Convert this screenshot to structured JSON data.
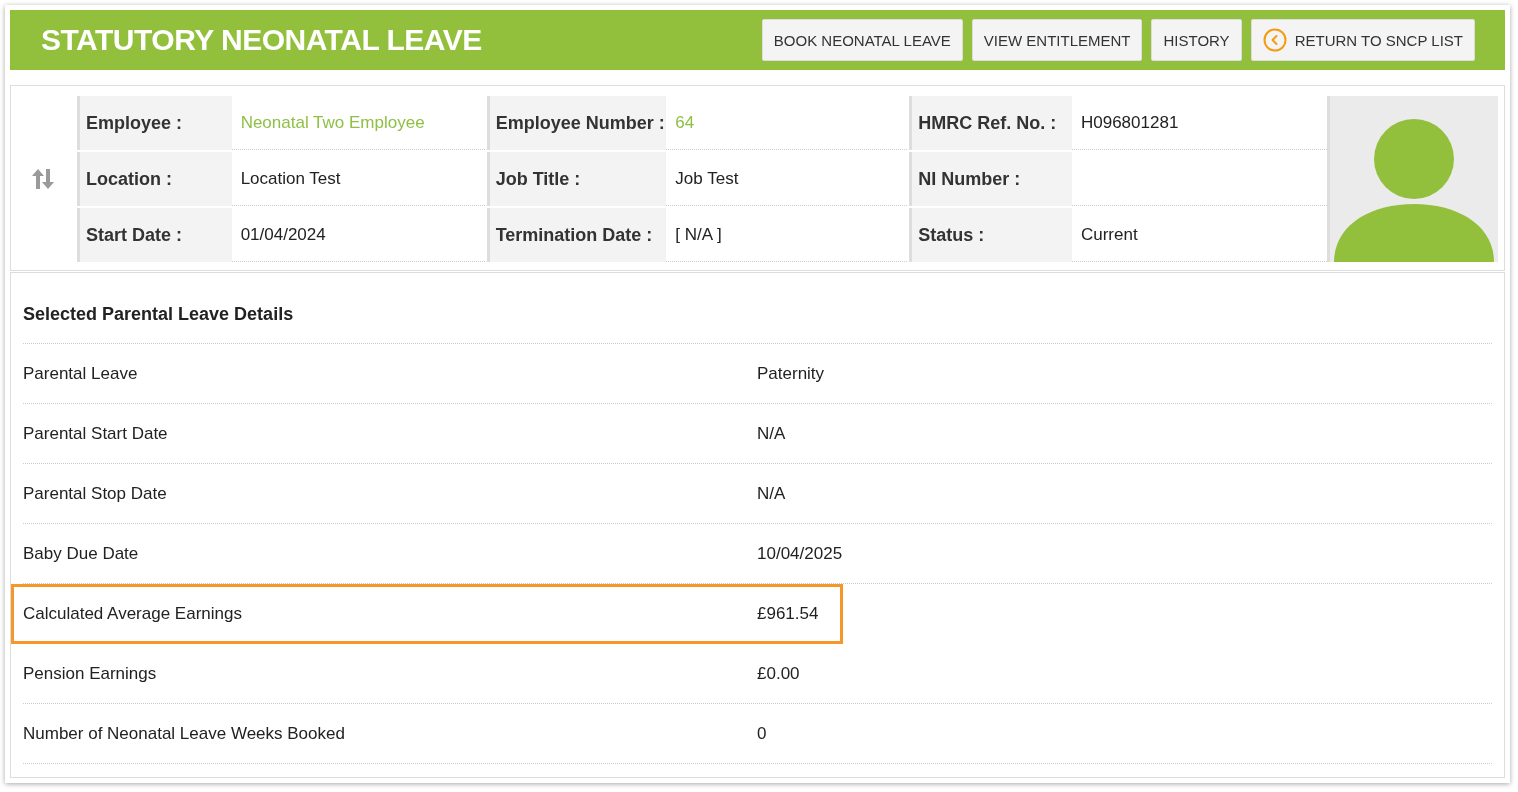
{
  "header": {
    "title": "STATUTORY NEONATAL LEAVE",
    "buttons": [
      {
        "label": "BOOK NEONATAL LEAVE",
        "kind": "plain"
      },
      {
        "label": "VIEW ENTITLEMENT",
        "kind": "plain"
      },
      {
        "label": "HISTORY",
        "kind": "plain"
      },
      {
        "label": "RETURN TO SNCP LIST",
        "kind": "back"
      }
    ]
  },
  "employee": {
    "fields": [
      {
        "label": "Employee :",
        "value": "Neonatal Two Employee",
        "link": true
      },
      {
        "label": "Employee Number :",
        "value": "64",
        "link": true
      },
      {
        "label": "HMRC Ref. No. :",
        "value": "H096801281",
        "link": false
      },
      {
        "label": "Location :",
        "value": "Location Test",
        "link": false
      },
      {
        "label": "Job Title :",
        "value": "Job Test",
        "link": false
      },
      {
        "label": "NI Number :"
      },
      {
        "label": "Start Date :",
        "value": "01/04/2024",
        "link": false
      },
      {
        "label": "Termination Date :",
        "value": "[ N/A ]",
        "link": false
      },
      {
        "label": "Status :",
        "value": "Current",
        "link": false
      }
    ]
  },
  "details": {
    "title": "Selected Parental Leave Details",
    "rows": [
      {
        "label": "Parental Leave",
        "value": "Paternity",
        "highlighted": false
      },
      {
        "label": "Parental Start Date",
        "value": "N/A",
        "highlighted": false
      },
      {
        "label": "Parental Stop Date",
        "value": "N/A",
        "highlighted": false
      },
      {
        "label": "Baby Due Date",
        "value": "10/04/2025",
        "highlighted": false
      },
      {
        "label": "Calculated Average Earnings",
        "value": "£961.54",
        "highlighted": true
      },
      {
        "label": "Pension Earnings",
        "value": "£0.00",
        "highlighted": false
      },
      {
        "label": "Number of Neonatal Leave Weeks Booked",
        "value": "0",
        "highlighted": false
      }
    ]
  }
}
